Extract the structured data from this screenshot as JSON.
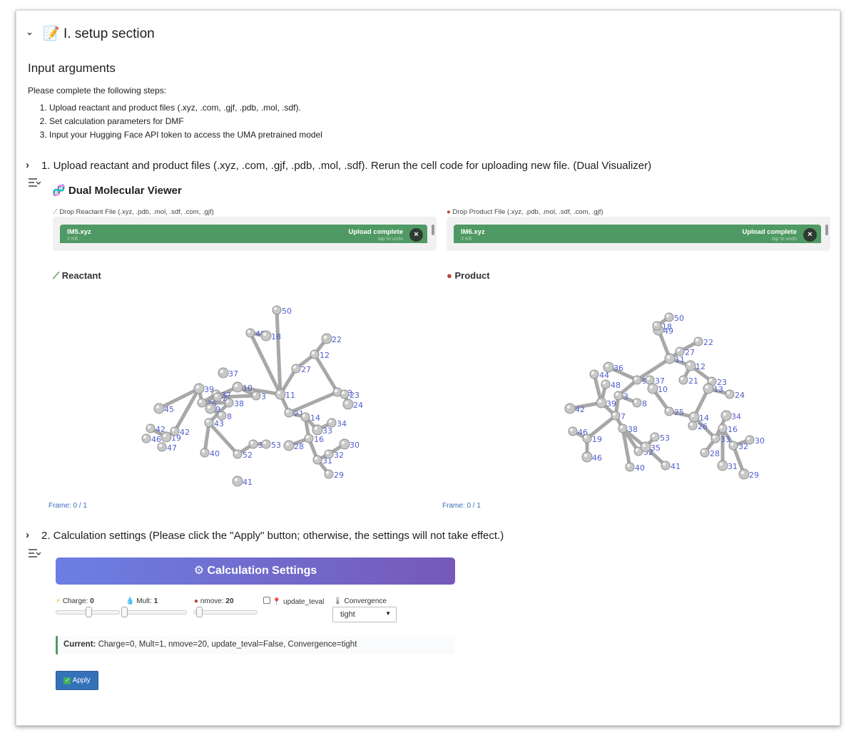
{
  "section": {
    "chevron": "⌄",
    "emoji": "📝",
    "title": "I. setup section"
  },
  "input_args": {
    "heading": "Input arguments",
    "intro": "Please complete the following steps:",
    "steps": [
      "Upload reactant and product files (.xyz, .com, .gjf, .pdb, .mol, .sdf).",
      "Set calculation parameters for DMF",
      "Input your Hugging Face API token to access the UMA pretrained model"
    ]
  },
  "upload_cell": {
    "chevron": "›",
    "title": "1. Upload reactant and product files (.xyz, .com, .gjf, .pdb, .mol, .sdf). Rerun the cell code for uploading new file. (Dual Visualizer)",
    "output_icon": "output-toggle-icon"
  },
  "viewer": {
    "emoji": "🧬",
    "title": "Dual Molecular Viewer",
    "reactant": {
      "drop_label": "Drop Reactant File (.xyz, .pdb, .mol, .sdf, .com, .gjf)",
      "file_name": "IM5.xyz",
      "file_size": "3 KB",
      "status": "Upload complete",
      "undo": "tap to undo",
      "label": "Reactant",
      "frame": "Frame: 0 / 1"
    },
    "product": {
      "drop_label": "Drop Product File (.xyz, .pdb, .mol, .sdf, .com, .gjf)",
      "file_name": "IM6.xyz",
      "file_size": "3 KB",
      "status": "Upload complete",
      "undo": "tap to undo",
      "label": "Product",
      "frame": "Frame: 0 / 1"
    },
    "atom_color": "#c8c8c8",
    "label_color": "#4f5fd0"
  },
  "settings_cell": {
    "chevron": "›",
    "title": "2. Calculation settings (Please click the \"Apply\" button; otherwise, the settings will not take effect.)"
  },
  "calc": {
    "banner": "Calculation Settings",
    "charge_label": "Charge:",
    "charge_value": "0",
    "charge_fraction": 0.5,
    "mult_label": "Mult:",
    "mult_value": "1",
    "mult_fraction": 0.0,
    "nmove_label": "nmove:",
    "nmove_value": "20",
    "nmove_fraction": 0.05,
    "update_teval_label": "update_teval",
    "update_teval_checked": false,
    "convergence_label": "Convergence",
    "convergence_value": "tight",
    "current_label": "Current:",
    "current_text": "Charge=0, Mult=1, nmove=20, update_teval=False, Convergence=tight",
    "apply_label": "Apply",
    "gradient_start": "#6c7fe3",
    "gradient_end": "#7659b8",
    "apply_color": "#3471b8"
  }
}
